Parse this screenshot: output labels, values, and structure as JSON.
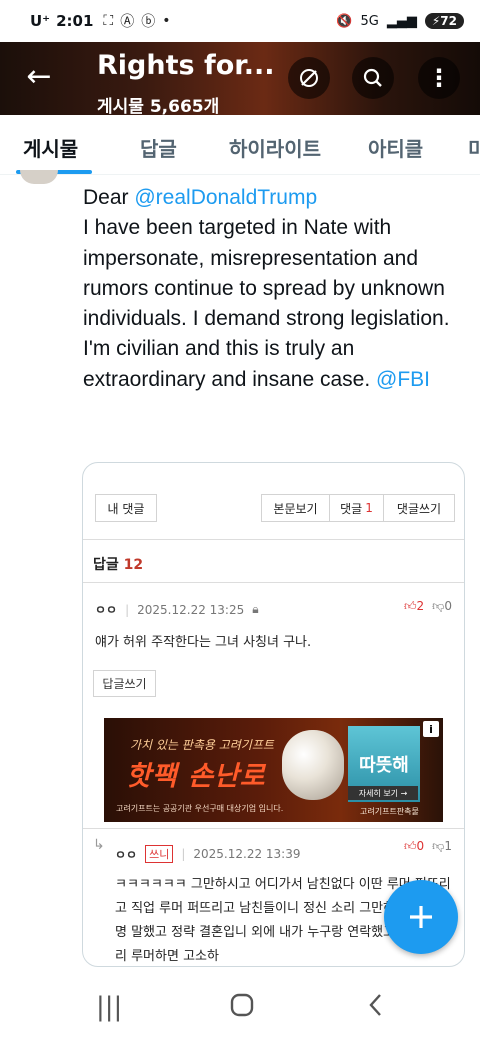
{
  "status_bar": {
    "carrier": "U⁺",
    "time": "2:01",
    "network": "5G",
    "battery": "72"
  },
  "header": {
    "title": "Rights for...",
    "subtitle": "게시물 5,665개"
  },
  "tabs": [
    {
      "label": "게시물",
      "active": true
    },
    {
      "label": "답글",
      "active": false
    },
    {
      "label": "하이라이트",
      "active": false
    },
    {
      "label": "아티클",
      "active": false
    },
    {
      "label": "미",
      "active": false
    }
  ],
  "tweet": {
    "greeting": "Dear ",
    "mention1": "@realDonaldTrump",
    "body": "I have been targeted in Nate with impersonate, misrepresentation and rumors continue to spread by unknown individuals. I demand strong legislation. I'm civilian and this is truly an extraordinary and insane case. ",
    "mention2": "@FBI"
  },
  "card": {
    "my_comment": "내 댓글",
    "view_post": "본문보기",
    "comments": "댓글",
    "comment_count": "1",
    "write_comment": "댓글쓰기",
    "replies_label": "답글",
    "reply_count": "12",
    "comment1": {
      "nick": "ㅇㅇ",
      "date": "2025.12.22 13:25",
      "up": "2",
      "down": "0",
      "text": "얘가 허위 주작한다는 그녀 사칭녀 구나."
    },
    "reply_button": "답글쓰기",
    "ad": {
      "tagline": "가치 있는 판촉용 고려기프트",
      "headline": "핫팩 손난로",
      "product": "따뜻해",
      "detail": "자세히 보기 →",
      "brand": "고려기프트판촉물",
      "footnote": "고려기프트는 공공기관 우선구매 대상기업 입니다."
    },
    "comment2": {
      "nick": "ㅇㅇ",
      "badge": "쓰니",
      "date": "2025.12.22 13:39",
      "up": "0",
      "down": "1",
      "text": "ㅋㅋㅋㅋㅋㅋ 그만하시고 어디가서 남친없다 이딴 루머 퍼뜨리고 직업 루머 퍼뜨리고 남친들이니 정신 소리 그만하세요 난 분명 말했고 정략 결혼입니 외에 내가 누구랑 연락했고 이딴 개소리 루머하면 고소하"
    }
  },
  "colors": {
    "accent": "#1d9bf0",
    "text": "#0f1419",
    "muted": "#536471"
  }
}
